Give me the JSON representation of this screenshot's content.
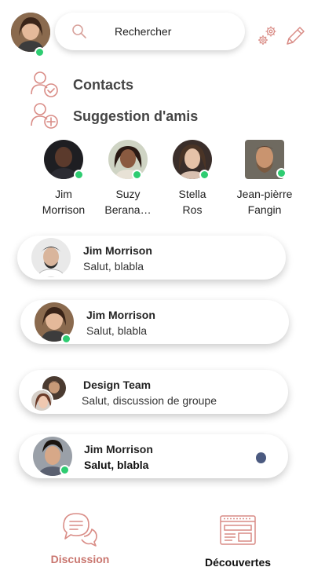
{
  "header": {
    "search_placeholder": "Rechercher",
    "accent_color": "#d98c86"
  },
  "sections": {
    "contacts": "Contacts",
    "suggestions": "Suggestion d'amis"
  },
  "suggestions": [
    {
      "line1": "Jim",
      "line2": "Morrison",
      "online": true
    },
    {
      "line1": "Suzy",
      "line2": "Berana…",
      "online": true
    },
    {
      "line1": "Stella",
      "line2": "Ros",
      "online": true
    },
    {
      "line1": "Jean-pièrre",
      "line2": "Fangin",
      "online": true
    }
  ],
  "chats": [
    {
      "title": "Jim Morrison",
      "message": "Salut, blabla",
      "online": false,
      "unread": false
    },
    {
      "title": "Jim Morrison",
      "message": "Salut, blabla",
      "online": true,
      "unread": false
    },
    {
      "title": "Design Team",
      "message": "Salut, discussion de groupe",
      "online": false,
      "unread": false
    },
    {
      "title": "Jim Morrison",
      "message": "Salut, blabla",
      "online": true,
      "unread": true
    }
  ],
  "nav": {
    "discussion": "Discussion",
    "decouvertes": "Découvertes",
    "active_color": "#c9766f"
  }
}
